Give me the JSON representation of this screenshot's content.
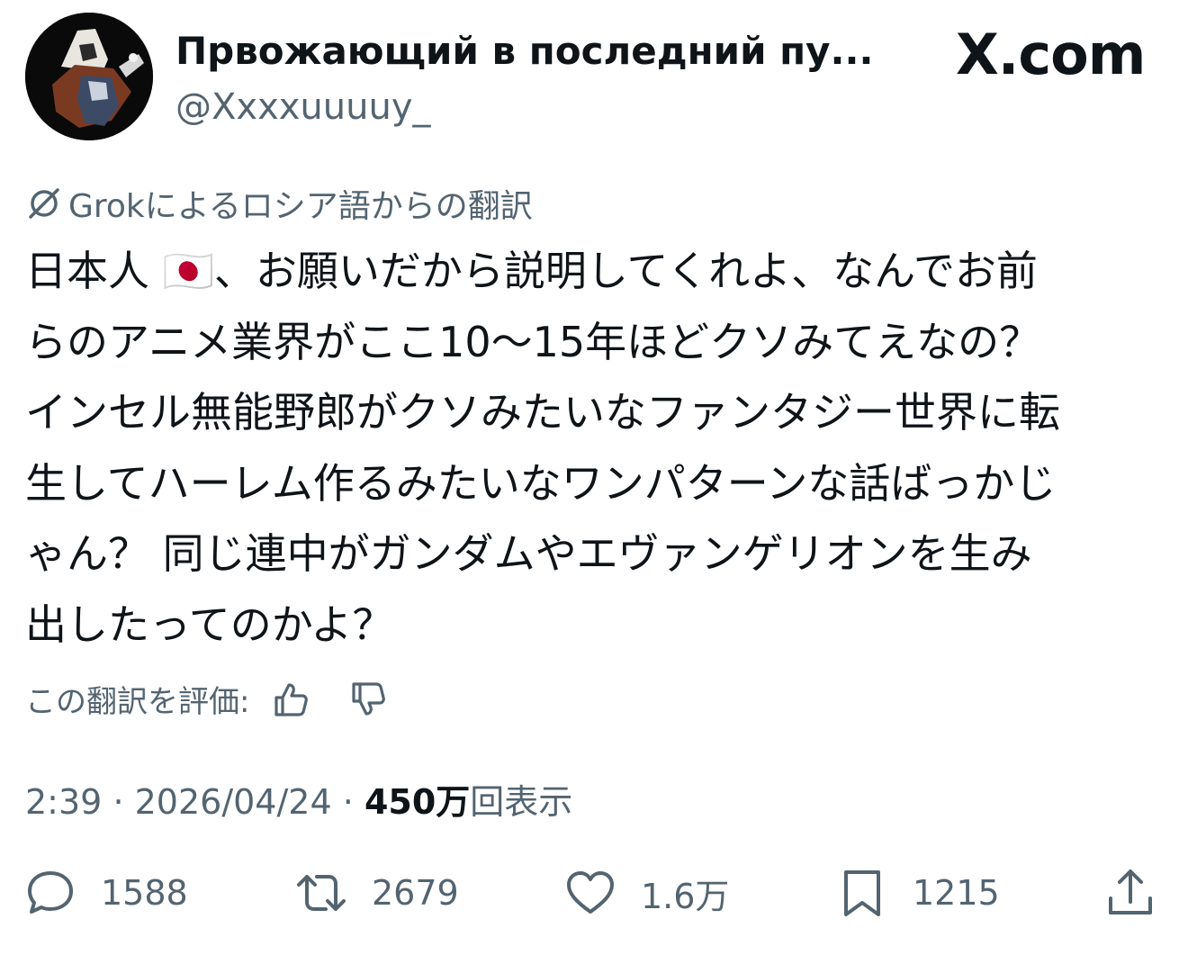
{
  "brand": {
    "label": "X.com"
  },
  "author": {
    "display_name": "Првожающий в последний пу...",
    "handle": "@Xxxxuuuuy_"
  },
  "translation": {
    "note": "Grokによるロシア語からの翻訳",
    "rate_label": "この翻訳を評価:"
  },
  "tweet": {
    "lines": [
      "日本人 🇯🇵、お願いだから説明してくれよ、なんでお前",
      "らのアニメ業界がここ10〜15年ほどクソみてえなの？",
      "インセル無能野郎がクソみたいなファンタジー世界に転",
      "生してハーレム作るみたいなワンパターンな話ばっかじ",
      "ゃん？ 同じ連中がガンダムやエヴァンゲリオンを生み",
      "出したってのかよ？"
    ]
  },
  "meta": {
    "time": "2:39",
    "separator": "·",
    "date": "2026/04/24",
    "views_number": "450万",
    "views_label": "回表示"
  },
  "actions": {
    "replies": "1588",
    "reposts": "2679",
    "likes": "1.6万",
    "bookmarks": "1215"
  },
  "colors": {
    "text_primary": "#0f1419",
    "text_secondary": "#536471",
    "background": "#ffffff"
  },
  "icons": {
    "translate": "grok-translate-icon",
    "thumbs_up": "thumbs-up-icon",
    "thumbs_down": "thumbs-down-icon",
    "reply": "reply-bubble-icon",
    "repost": "repost-arrows-icon",
    "like": "heart-icon",
    "bookmark": "bookmark-icon",
    "share": "share-upload-icon"
  }
}
